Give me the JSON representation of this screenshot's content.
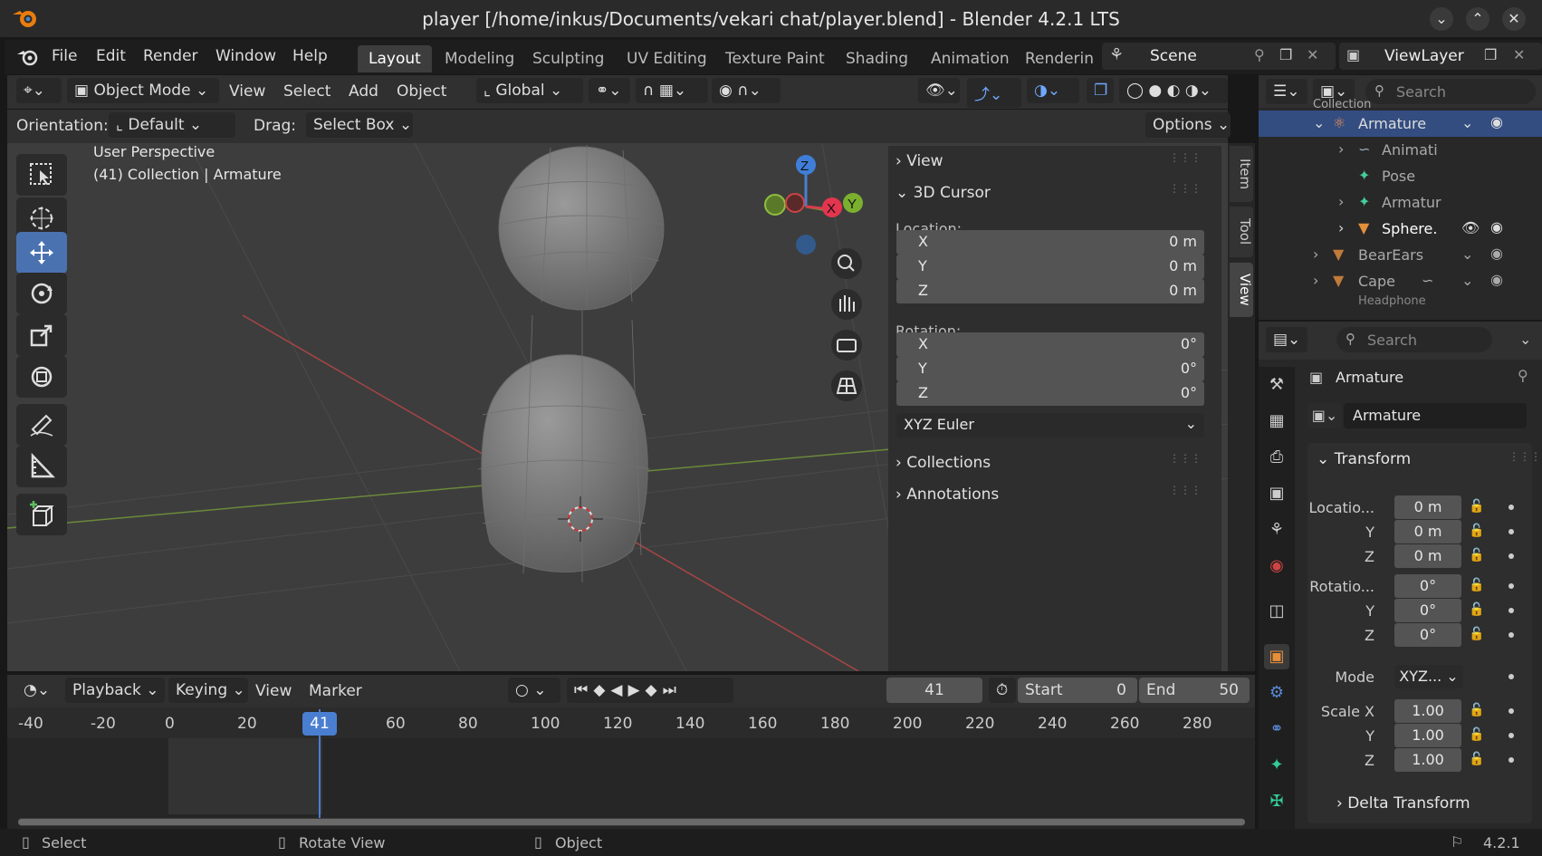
{
  "window": {
    "title": "player [/home/inkus/Documents/vekari chat/player.blend] - Blender 4.2.1 LTS"
  },
  "menu": {
    "items": [
      "File",
      "Edit",
      "Render",
      "Window",
      "Help"
    ]
  },
  "workspaces": [
    "Layout",
    "Modeling",
    "Sculpting",
    "UV Editing",
    "Texture Paint",
    "Shading",
    "Animation",
    "Renderin"
  ],
  "scene": {
    "label": "Scene"
  },
  "viewlayer": {
    "label": "ViewLayer"
  },
  "header": {
    "mode": "Object Mode",
    "view": "View",
    "select": "Select",
    "add": "Add",
    "object": "Object",
    "transform_space": "Global"
  },
  "tool_settings": {
    "orientation_label": "Orientation:",
    "orientation_value": "Default",
    "drag_label": "Drag:",
    "drag_value": "Select Box",
    "options": "Options"
  },
  "viewport": {
    "perspective": "User Perspective",
    "context": "(41) Collection | Armature"
  },
  "gizmo": {
    "z": "Z",
    "x": "X",
    "y": "Y"
  },
  "npanel": {
    "view": "View",
    "cursor": "3D Cursor",
    "location_label": "Location:",
    "location": [
      {
        "axis": "X",
        "value": "0 m"
      },
      {
        "axis": "Y",
        "value": "0 m"
      },
      {
        "axis": "Z",
        "value": "0 m"
      }
    ],
    "rotation_label": "Rotation:",
    "rotation": [
      {
        "axis": "X",
        "value": "0°"
      },
      {
        "axis": "Y",
        "value": "0°"
      },
      {
        "axis": "Z",
        "value": "0°"
      }
    ],
    "rotation_mode": "XYZ Euler",
    "collections": "Collections",
    "annotations": "Annotations",
    "tabs": [
      "Item",
      "Tool",
      "View"
    ]
  },
  "outliner": {
    "search_placeholder": "Search",
    "rows": [
      {
        "label": "Collection"
      },
      {
        "label": "Armature"
      },
      {
        "label": "Animati"
      },
      {
        "label": "Pose"
      },
      {
        "label": "Armatur"
      },
      {
        "label": "Sphere."
      },
      {
        "label": "BearEars"
      },
      {
        "label": "Cape"
      },
      {
        "label": "Headphone"
      }
    ]
  },
  "properties": {
    "search_placeholder": "Search",
    "object_name": "Armature",
    "data_name": "Armature",
    "transform": "Transform",
    "location_label": "Locatio...",
    "location": [
      "0 m",
      "0 m",
      "0 m"
    ],
    "rotation_label": "Rotatio...",
    "rotation": [
      "0°",
      "0°",
      "0°"
    ],
    "mode_label": "Mode",
    "mode_value": "XYZ...",
    "scale_label": "Scale X",
    "scale": [
      "1.00",
      "1.00",
      "1.00"
    ],
    "y_label": "Y",
    "z_label": "Z",
    "delta": "Delta Transform"
  },
  "timeline": {
    "playback": "Playback",
    "keying": "Keying",
    "view": "View",
    "marker": "Marker",
    "current_frame": "41",
    "start_label": "Start",
    "start": "0",
    "end_label": "End",
    "end": "50",
    "ruler": [
      "-40",
      "-20",
      "0",
      "20",
      "41",
      "60",
      "80",
      "100",
      "120",
      "140",
      "160",
      "180",
      "200",
      "220",
      "240",
      "260",
      "280"
    ]
  },
  "status": {
    "select": "Select",
    "rotate": "Rotate View",
    "object": "Object",
    "version": "4.2.1"
  }
}
